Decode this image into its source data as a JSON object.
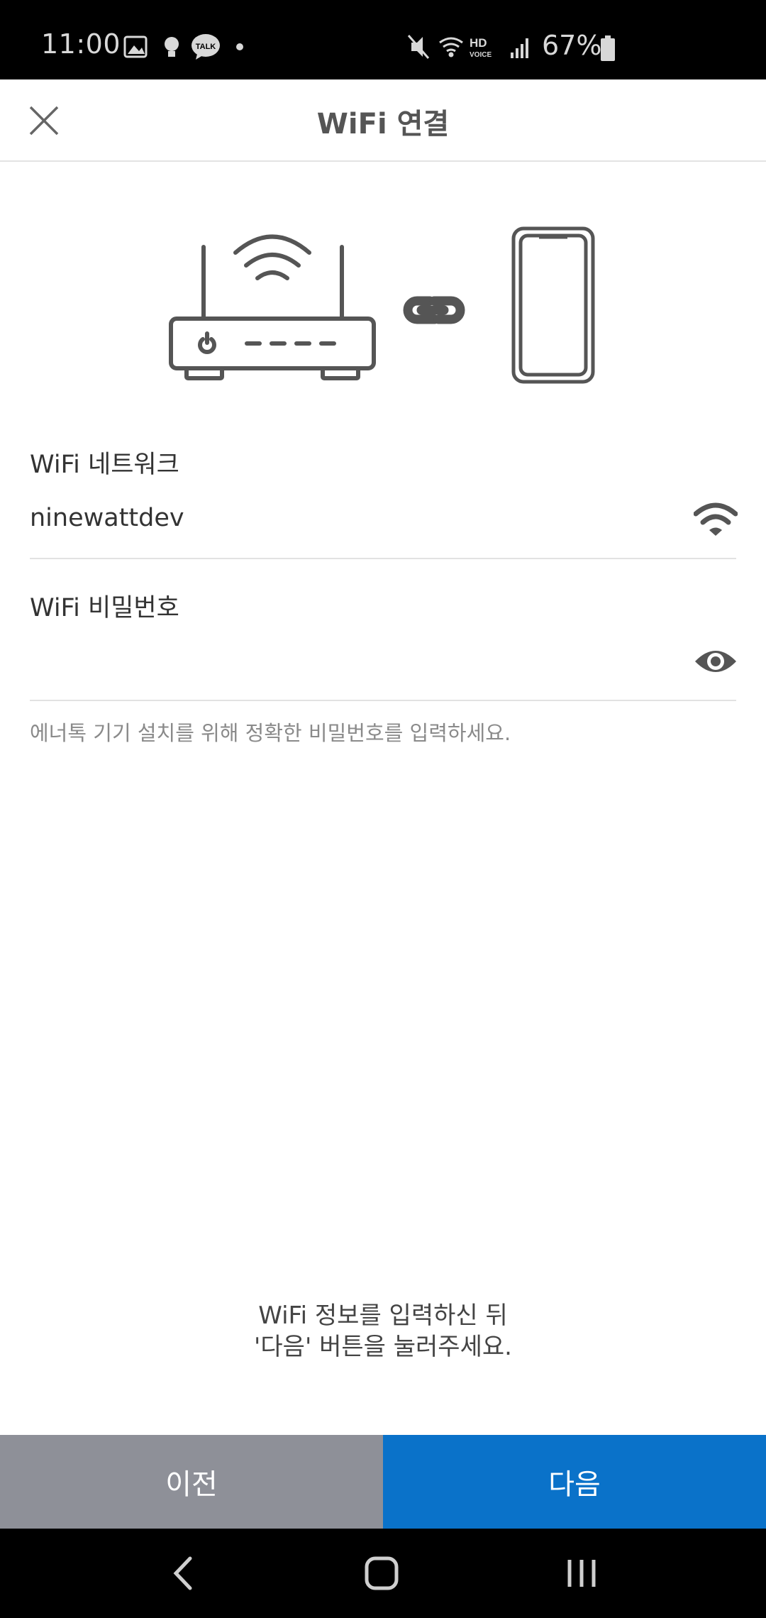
{
  "status_bar": {
    "time": "11:00",
    "battery": "67%",
    "notification_icons": [
      "image-icon",
      "bulb-icon",
      "kakaotalk-icon",
      "dot-icon"
    ],
    "talk_label": "TALK",
    "hd_label": "HD",
    "voice_label": "VOICE",
    "system_icons": [
      "mute-icon",
      "wifi-icon",
      "hd-voice-icon",
      "signal-icon",
      "battery-icon"
    ]
  },
  "header": {
    "title": "WiFi 연결",
    "close_icon": "close-icon"
  },
  "illustration": {
    "icons": [
      "router-icon",
      "link-icon",
      "phone-icon"
    ]
  },
  "form": {
    "network": {
      "label": "WiFi 네트워크",
      "value": "ninewattdev",
      "icon": "wifi-icon"
    },
    "password": {
      "label": "WiFi 비밀번호",
      "value": "",
      "icon": "eye-icon"
    },
    "hint": "에너톡 기기 설치를 위해 정확한 비밀번호를 입력하세요."
  },
  "instruction": {
    "line1": "WiFi 정보를 입력하신 뒤",
    "line2": "'다음' 버튼을 눌러주세요."
  },
  "buttons": {
    "prev": "이전",
    "next": "다음"
  },
  "colors": {
    "prev_button": "#8e9098",
    "next_button": "#0a72c9",
    "icon_gray": "#555555"
  },
  "nav_bar": {
    "icons": [
      "back-icon",
      "home-icon",
      "recents-icon"
    ]
  }
}
